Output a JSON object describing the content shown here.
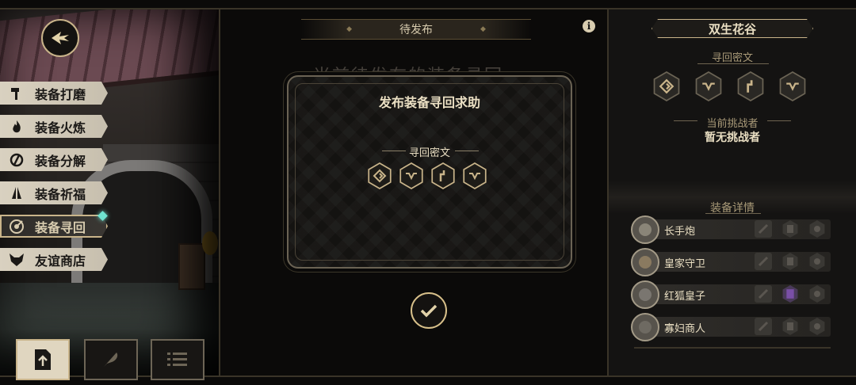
{
  "sidebar": {
    "items": [
      {
        "label": "装备打磨",
        "icon": "hammer-icon"
      },
      {
        "label": "装备火炼",
        "icon": "flame-icon"
      },
      {
        "label": "装备分解",
        "icon": "break-icon"
      },
      {
        "label": "装备祈福",
        "icon": "pray-hands-icon"
      },
      {
        "label": "装备寻回",
        "icon": "target-icon",
        "active": true
      },
      {
        "label": "友谊商店",
        "icon": "fox-icon"
      }
    ]
  },
  "center": {
    "tab_label": "待发布",
    "background_title": "当前待发布的装备寻回",
    "info_icon": "i"
  },
  "dialog": {
    "title": "发布装备寻回求助",
    "cipher_label": "寻回密文",
    "runes": [
      "diamond-rune-icon",
      "wave-rune-icon",
      "step-rune-icon",
      "wave-rune-icon"
    ]
  },
  "panel": {
    "title": "双生花谷",
    "cipher_label": "寻回密文",
    "runes": [
      "diamond-rune-icon",
      "wave-rune-icon",
      "step-rune-icon",
      "wave-rune-icon"
    ],
    "challenger_label": "当前挑战者",
    "challenger_value": "暂无挑战者",
    "detail_label": "装备详情",
    "heroes": [
      {
        "name": "长手炮"
      },
      {
        "name": "皇家守卫"
      },
      {
        "name": "红狐皇子"
      },
      {
        "name": "寡妇商人"
      }
    ]
  },
  "colors": {
    "accent": "#c9b48a",
    "armor_active": "#7a4fa8"
  }
}
